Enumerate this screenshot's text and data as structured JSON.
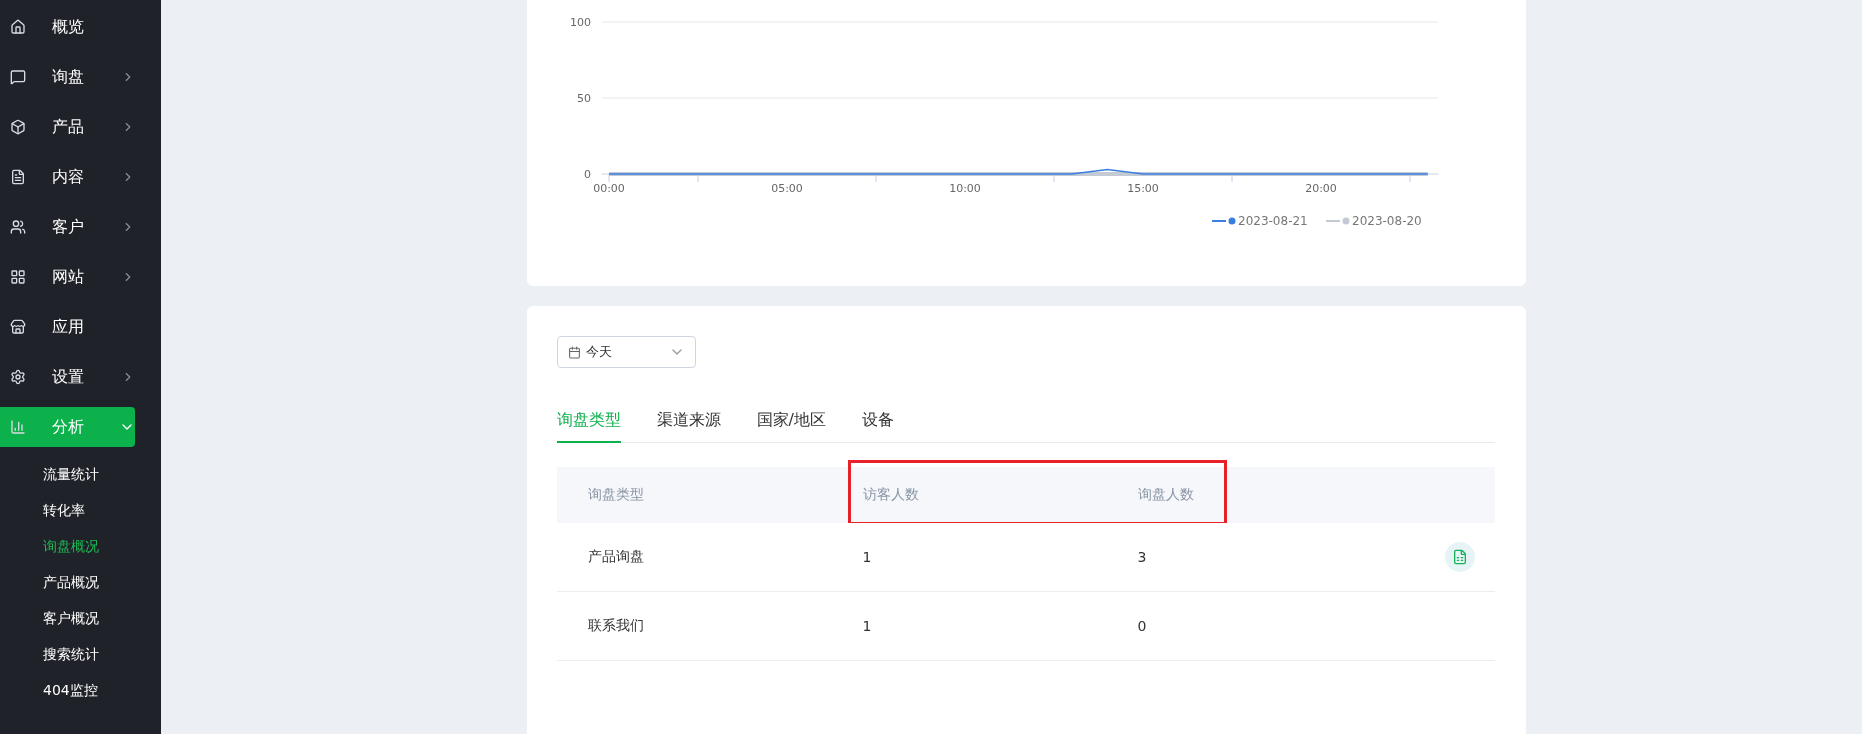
{
  "sidebar": {
    "items": [
      {
        "label": "概览",
        "kind": "link",
        "selected": false
      },
      {
        "label": "询盘",
        "kind": "group",
        "expanded": false,
        "selected": false
      },
      {
        "label": "产品",
        "kind": "group",
        "expanded": false,
        "selected": false
      },
      {
        "label": "内容",
        "kind": "group",
        "expanded": false,
        "selected": false
      },
      {
        "label": "客户",
        "kind": "group",
        "expanded": false,
        "selected": false
      },
      {
        "label": "网站",
        "kind": "group",
        "expanded": false,
        "selected": false
      },
      {
        "label": "应用",
        "kind": "link",
        "selected": false
      },
      {
        "label": "设置",
        "kind": "group",
        "expanded": false,
        "selected": false
      },
      {
        "label": "分析",
        "kind": "group",
        "expanded": true,
        "selected": true,
        "children": [
          {
            "label": "流量统计",
            "selected": false
          },
          {
            "label": "转化率",
            "selected": false
          },
          {
            "label": "询盘概况",
            "selected": true
          },
          {
            "label": "产品概况",
            "selected": false
          },
          {
            "label": "客户概况",
            "selected": false
          },
          {
            "label": "搜索统计",
            "selected": false
          },
          {
            "label": "404监控",
            "selected": false
          }
        ]
      }
    ]
  },
  "trend_card": {
    "chart_data": {
      "type": "line",
      "x": [
        0,
        1,
        2,
        3,
        4,
        5,
        6,
        7,
        8,
        9,
        10,
        11,
        12,
        13,
        14,
        15,
        16,
        17,
        18,
        19,
        20,
        21,
        22,
        23
      ],
      "legend": "bottom-right",
      "series": [
        {
          "name": "2023-08-21",
          "color": "#3a7fe0",
          "values": [
            0,
            0,
            0,
            0,
            0,
            0,
            0,
            0,
            0,
            0,
            0,
            0,
            0,
            0,
            3,
            0,
            0,
            0,
            0,
            0,
            0,
            0,
            0,
            0
          ]
        },
        {
          "name": "2023-08-20",
          "color": "#c4cad4",
          "values": [
            0,
            0,
            0,
            0,
            0,
            0,
            0,
            0,
            0,
            0,
            0,
            0,
            0,
            0,
            0,
            0,
            0,
            0,
            0,
            0,
            0,
            0,
            0,
            0
          ]
        }
      ],
      "xlim": [
        -0.2,
        23.3
      ],
      "ylim": [
        0,
        100
      ],
      "yticks": [
        0,
        50,
        100
      ],
      "xticks": [
        {
          "value": 0,
          "label": "00:00"
        },
        {
          "value": 5,
          "label": "05:00"
        },
        {
          "value": 10,
          "label": "10:00"
        },
        {
          "value": 15,
          "label": "15:00"
        },
        {
          "value": 20,
          "label": "20:00"
        }
      ]
    }
  },
  "detail_card": {
    "date_select": {
      "value": "今天"
    },
    "tabs": [
      {
        "label": "询盘类型",
        "selected": true
      },
      {
        "label": "渠道来源",
        "selected": false
      },
      {
        "label": "国家/地区",
        "selected": false
      },
      {
        "label": "设备",
        "selected": false
      }
    ],
    "table": {
      "columns": [
        "询盘类型",
        "访客人数",
        "询盘人数"
      ],
      "rows": [
        {
          "cells": [
            "产品询盘",
            "1",
            "3"
          ],
          "show_action": true
        },
        {
          "cells": [
            "联系我们",
            "1",
            "0"
          ],
          "show_action": false
        }
      ]
    }
  }
}
